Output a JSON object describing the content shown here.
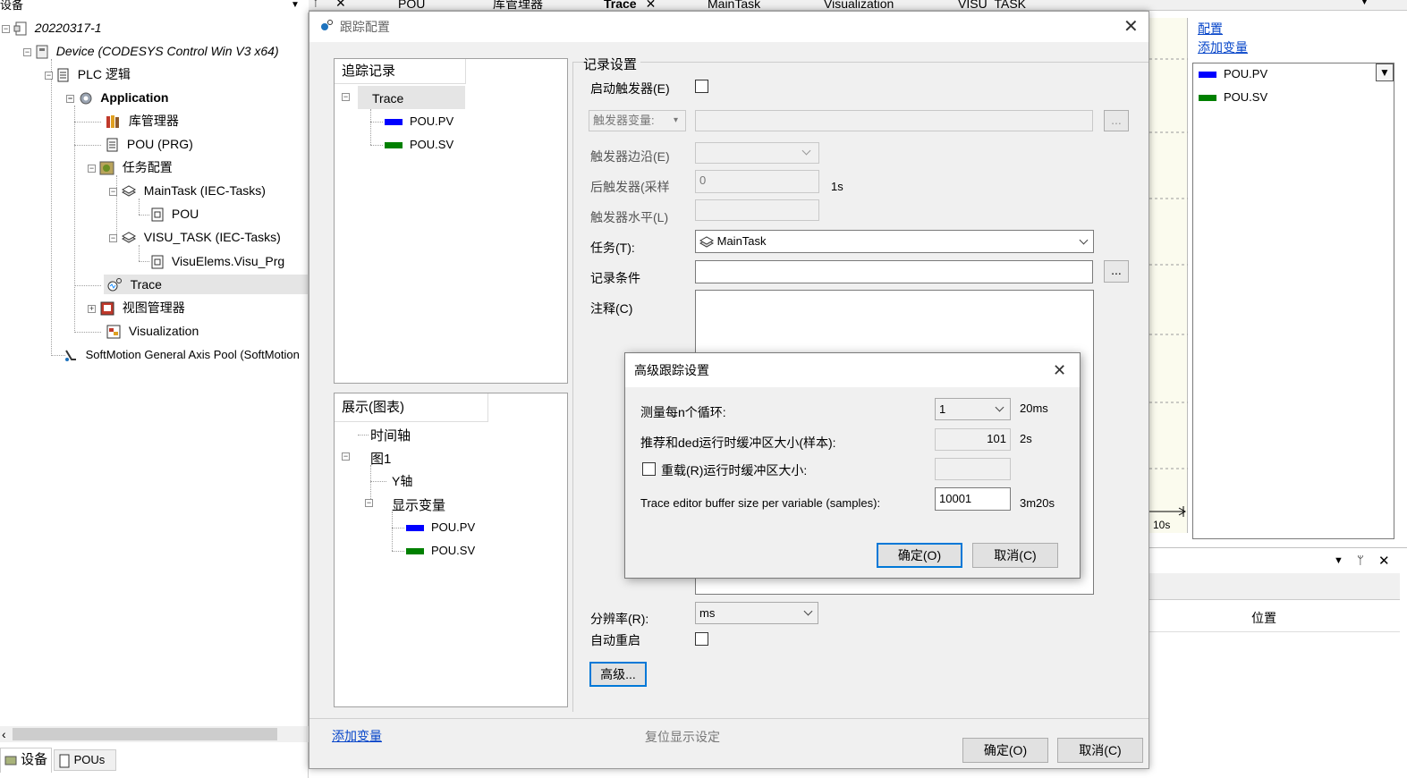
{
  "device_panel": {
    "header": "设备",
    "tree": {
      "project": "20220317-1",
      "device": "Device (CODESYS Control Win V3 x64)",
      "plc_logic": "PLC 逻辑",
      "application": "Application",
      "library_manager": "库管理器",
      "pou_prg": "POU (PRG)",
      "task_config": "任务配置",
      "main_task": "MainTask (IEC-Tasks)",
      "pou": "POU",
      "visu_task": "VISU_TASK (IEC-Tasks)",
      "visu_prg": "VisuElems.Visu_Prg",
      "trace": "Trace",
      "view_manager": "视图管理器",
      "visualization": "Visualization",
      "softmotion": "SoftMotion General Axis Pool (SoftMotion"
    },
    "bottom_tabs": [
      "设备",
      "POUs"
    ]
  },
  "tab_strip": {
    "tabs": [
      "POU",
      "库管理器",
      "Trace",
      "MainTask",
      "Visualization",
      "VISU_TASK"
    ]
  },
  "right_panel": {
    "config_link": "配置",
    "add_variable_link": "添加变量",
    "legend": [
      {
        "name": "POU.PV",
        "color": "#0000ff"
      },
      {
        "name": "POU.SV",
        "color": "#008000"
      }
    ],
    "axis_label": "10s",
    "column_header": "位置"
  },
  "trace_dialog": {
    "title": "跟踪配置",
    "record_tree": {
      "header": "追踪记录",
      "root": "Trace",
      "vars": [
        "POU.PV",
        "POU.SV"
      ]
    },
    "display_tree": {
      "header": "展示(图表)",
      "time_axis": "时间轴",
      "chart": "图1",
      "y_axis": "Y轴",
      "display_vars": "显示变量",
      "vars": [
        "POU.PV",
        "POU.SV"
      ]
    },
    "record_settings": {
      "group": "记录设置",
      "enable_trigger": "启动触发器(E)",
      "trigger_var": "触发器变量:",
      "trigger_edge": "触发器边沿(E)",
      "post_trigger": "后触发器(采样",
      "post_trigger_value": "0",
      "post_trigger_unit": "1s",
      "trigger_level": "触发器水平(L)",
      "task_label": "任务(T):",
      "task_value": "MainTask",
      "condition": "记录条件",
      "comment": "注释(C)",
      "resolution": "分辨率(R):",
      "resolution_value": "ms",
      "auto_restart": "自动重启",
      "advanced_button": "高级..."
    },
    "ellipsis": "...",
    "add_variable": "添加变量",
    "reset_display": "复位显示设定",
    "ok_button": "确定(O)",
    "cancel_button": "取消(C)"
  },
  "advanced_dialog": {
    "title": "高级跟踪设置",
    "measure_label": "测量每n个循环:",
    "measure_value": "1",
    "measure_unit": "20ms",
    "recommended_label": "推荐和ded运行时缓冲区大小(样本):",
    "recommended_value": "101",
    "recommended_unit": "2s",
    "override_label": "重载(R)运行时缓冲区大小:",
    "editor_label": "Trace editor buffer size per variable (samples):",
    "editor_value": "10001",
    "editor_unit": "3m20s",
    "ok_button": "确定(O)",
    "cancel_button": "取消(C)"
  }
}
